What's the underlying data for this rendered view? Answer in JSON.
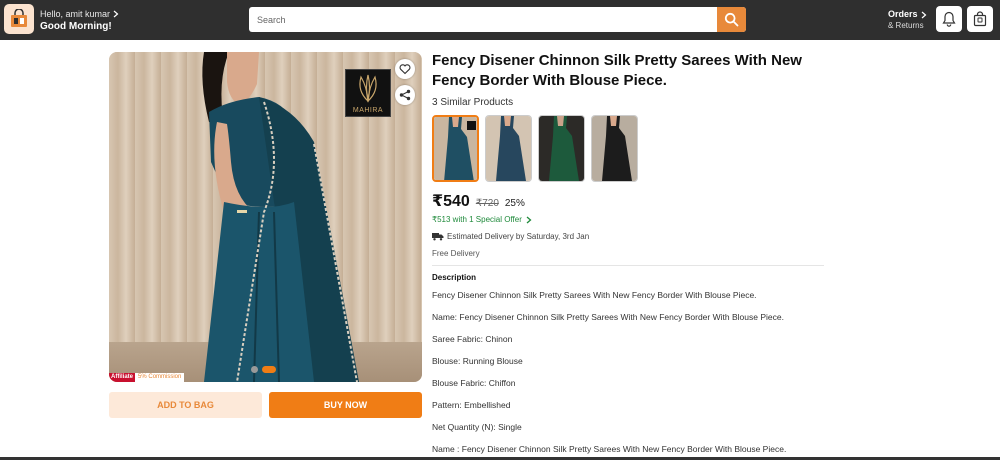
{
  "header": {
    "greeting": "Hello, amit kumar",
    "subtitle": "Good Morning!",
    "search_placeholder": "Search",
    "orders_label": "Orders",
    "orders_sub": "& Returns"
  },
  "gallery": {
    "brand_logo_text": "MAHIRA",
    "affiliate_tag": "Affiliate",
    "commission": "5% Commission",
    "slide_count": 2,
    "active_slide": 2
  },
  "actions": {
    "add_to_bag": "ADD TO BAG",
    "buy_now": "BUY NOW"
  },
  "product": {
    "title": "Fency Disener Chinnon Silk Pretty Sarees With New Fency Border With Blouse Piece.",
    "similar_products": "3 Similar Products",
    "thumbnails": [
      {
        "name": "variant-teal-selected",
        "color": "#1f4f63"
      },
      {
        "name": "variant-blue",
        "color": "#27475e"
      },
      {
        "name": "variant-green",
        "color": "#1d5a3c"
      },
      {
        "name": "variant-black",
        "color": "#1c1c1c"
      }
    ],
    "price": "₹540",
    "mrp": "₹720",
    "discount": "25%",
    "offer": "₹513 with 1 Special Offer",
    "delivery": "Estimated Delivery by Saturday, 3rd Jan",
    "free_delivery": "Free Delivery"
  },
  "description": {
    "heading": "Description",
    "lines": [
      "Fency Disener Chinnon Silk Pretty Sarees With New Fency Border With Blouse Piece.",
      "Name: Fency Disener Chinnon Silk Pretty Sarees With New Fency Border With Blouse Piece.",
      "Saree Fabric: Chinon",
      "Blouse: Running Blouse",
      "Blouse Fabric: Chiffon",
      "Pattern: Embellished",
      "Net Quantity (N): Single",
      "Name : Fency Disener Chinnon Silk Pretty Sarees With New Fency Border With Blouse Piece."
    ]
  },
  "colors": {
    "accent": "#f07d15",
    "header_bg": "#2f2f2f",
    "offer_green": "#1f8a3b"
  }
}
